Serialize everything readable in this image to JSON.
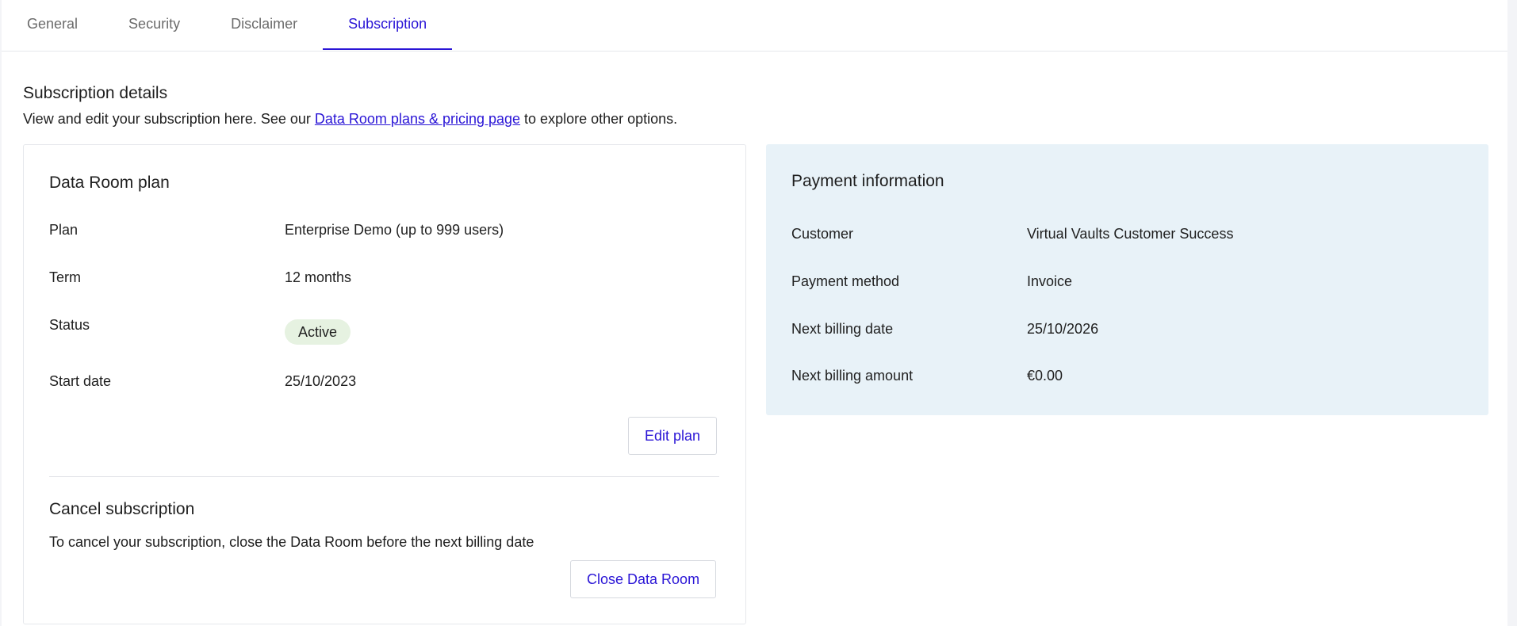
{
  "tabs": [
    {
      "label": "General",
      "active": false
    },
    {
      "label": "Security",
      "active": false
    },
    {
      "label": "Disclaimer",
      "active": false
    },
    {
      "label": "Subscription",
      "active": true
    }
  ],
  "section": {
    "title": "Subscription details",
    "desc_before": "View and edit your subscription here. See our ",
    "link_text": "Data Room plans & pricing page",
    "desc_after": " to explore other options."
  },
  "plan_card": {
    "title": "Data Room plan",
    "rows": {
      "plan": {
        "label": "Plan",
        "value": "Enterprise Demo  (up to 999 users)"
      },
      "term": {
        "label": "Term",
        "value": "12 months"
      },
      "status": {
        "label": "Status",
        "value": "Active"
      },
      "start_date": {
        "label": "Start date",
        "value": "25/10/2023"
      }
    },
    "edit_button": "Edit plan",
    "cancel_title": "Cancel subscription",
    "cancel_desc": "To cancel your subscription, close the Data Room before the next billing date",
    "close_button": "Close Data Room"
  },
  "payment_card": {
    "title": "Payment information",
    "rows": {
      "customer": {
        "label": "Customer",
        "value": "Virtual Vaults Customer Success"
      },
      "method": {
        "label": "Payment method",
        "value": "Invoice"
      },
      "next_date": {
        "label": "Next billing date",
        "value": "25/10/2026"
      },
      "next_amount": {
        "label": "Next billing amount",
        "value": "€0.00"
      }
    }
  },
  "colors": {
    "accent": "#2a15d6",
    "status_active_bg": "#e6f2e1",
    "payment_card_bg": "#e8f2f8"
  }
}
